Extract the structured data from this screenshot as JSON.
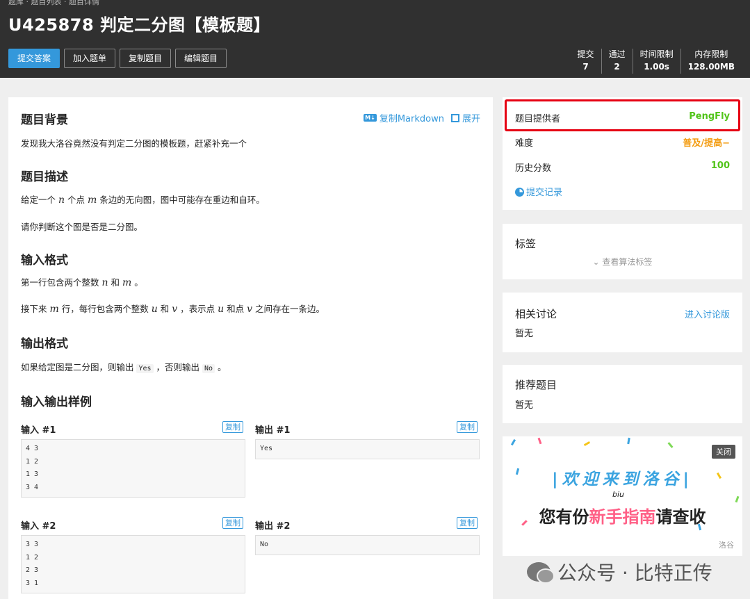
{
  "header": {
    "breadcrumb": "题库 · 题目列表 · 题目详情",
    "title": "U425878 判定二分图【模板题】",
    "buttons": {
      "submit": "提交答案",
      "add_list": "加入题单",
      "copy_problem": "复制题目",
      "edit_problem": "编辑题目"
    },
    "stats": [
      {
        "label": "提交",
        "value": "7"
      },
      {
        "label": "通过",
        "value": "2"
      },
      {
        "label": "时间限制",
        "value": "1.00s"
      },
      {
        "label": "内存限制",
        "value": "128.00MB"
      }
    ]
  },
  "problem": {
    "copy_markdown": "复制Markdown",
    "md_badge": "M↓",
    "expand": "展开",
    "background_title": "题目背景",
    "background_text": "发现我大洛谷竟然没有判定二分图的模板题，赶紧补充一个",
    "description_title": "题目描述",
    "description_line1": {
      "p1": "给定一个 ",
      "v1": "n",
      "p2": " 个点 ",
      "v2": "m",
      "p3": " 条边的无向图，图中可能存在重边和自环。"
    },
    "description_line2": "请你判断这个图是否是二分图。",
    "input_title": "输入格式",
    "input_line1": {
      "p1": "第一行包含两个整数 ",
      "v1": "n",
      "p2": " 和 ",
      "v2": "m",
      "p3": " 。"
    },
    "input_line2": {
      "p1": "接下来 ",
      "v1": "m",
      "p2": " 行，每行包含两个整数 ",
      "v2": "u",
      "p3": " 和 ",
      "v3": "v",
      "p4": " ，表示点 ",
      "v4": "u",
      "p5": " 和点 ",
      "v5": "v",
      "p6": " 之间存在一条边。"
    },
    "output_title": "输出格式",
    "output_line": {
      "p1": "如果给定图是二分图，则输出 ",
      "c1": "Yes",
      "p2": " ，否则输出 ",
      "c2": "No",
      "p3": " 。"
    },
    "samples_title": "输入输出样例",
    "copy_label": "复制",
    "samples": [
      {
        "input_label": "输入 #1",
        "output_label": "输出 #1",
        "input": [
          "4 3",
          "1 2",
          "1 3",
          "3 4"
        ],
        "output": [
          "Yes"
        ]
      },
      {
        "input_label": "输入 #2",
        "output_label": "输出 #2",
        "input": [
          "3 3",
          "1 2",
          "2 3",
          "3 1"
        ],
        "output": [
          "No"
        ]
      }
    ]
  },
  "sidebar": {
    "info": {
      "provider_label": "题目提供者",
      "provider_value": "PengFly",
      "difficulty_label": "难度",
      "difficulty_value": "普及/提高−",
      "score_label": "历史分数",
      "score_value": "100",
      "records_link": "提交记录"
    },
    "tags": {
      "title": "标签",
      "view_link": "查看算法标签"
    },
    "discussion": {
      "title": "相关讨论",
      "link": "进入讨论版",
      "empty": "暂无"
    },
    "recommend": {
      "title": "推荐题目",
      "empty": "暂无"
    },
    "ad": {
      "close": "关闭",
      "welcome": "|欢迎来到洛谷|",
      "biu": "biu",
      "guide_p1": "您有份",
      "guide_pink": "新手指南",
      "guide_p2": "请查收",
      "logo": "洛谷"
    }
  },
  "watermark": "公众号 · 比特正传",
  "colors": {
    "accent": "#3498db",
    "header_bg": "#303030",
    "provider": "#52c41a",
    "difficulty": "#f39c11",
    "score": "#52c41a",
    "highlight": "#e60012"
  }
}
